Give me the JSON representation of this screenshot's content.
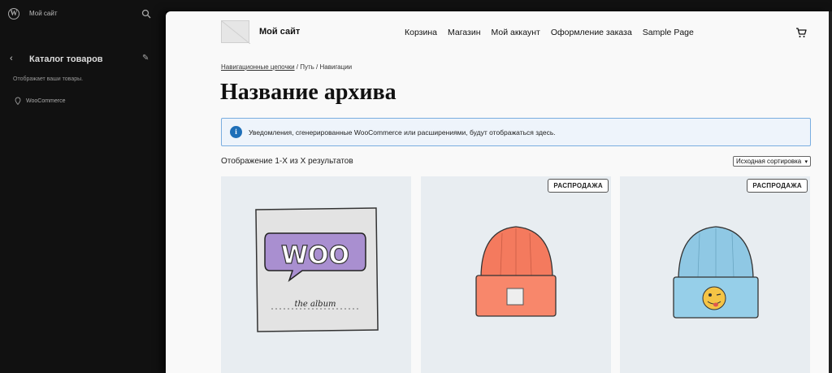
{
  "sidebar": {
    "site_name": "Мой сайт",
    "title": "Каталог товаров",
    "description": "Отображает ваши товары.",
    "item": "WooCommerce"
  },
  "header": {
    "site_title": "Мой сайт",
    "nav": [
      "Корзина",
      "Магазин",
      "Мой аккаунт",
      "Оформление заказа",
      "Sample Page"
    ]
  },
  "breadcrumb": {
    "link": "Навигационные цепочки",
    "rest": " / Путь / Навигации"
  },
  "archive_title": "Название архива",
  "notice": "Уведомления, сгенерированные WooCommerce или расширениями, будут отображаться здесь.",
  "result_count": "Отображение 1-X из X результатов",
  "sort": {
    "selected": "Исходная сортировка"
  },
  "products": [
    {
      "badge": "",
      "image": "woo-album",
      "woo_text": "WOO",
      "album_text": "the album"
    },
    {
      "badge": "РАСПРОДАЖА",
      "image": "orange-beanie"
    },
    {
      "badge": "РАСПРОДАЖА",
      "image": "blue-beanie"
    }
  ],
  "colors": {
    "accent": "#1e6fb8",
    "notice_border": "#7aaee0",
    "sidebar_bg": "#111111",
    "woo_purple": "#a98fd0"
  }
}
